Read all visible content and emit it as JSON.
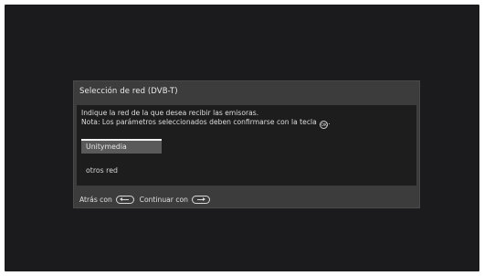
{
  "dialog": {
    "title": "Selección de red (DVB-T)",
    "instruction": "Indique la red de la que desea recibir las emisoras.",
    "note": "Nota: Los parámetros seleccionados deben confirmarse con la tecla",
    "ok_key_label": "OK",
    "networks": [
      {
        "label": "Unitymedia",
        "selected": true
      },
      {
        "label": "otros red",
        "selected": false
      }
    ],
    "footer": {
      "back_label": "Atrás con",
      "continue_label": "Continuar con"
    }
  },
  "colors": {
    "screen_background": "#1b1b1d",
    "dialog_background": "#3c3c3c",
    "body_background": "#1d1d1e",
    "selected_item": "#5a5a5a",
    "text": "#e6e6e6"
  },
  "icons": {
    "ok_key": "ok-button-icon",
    "back_key": "back-button-icon",
    "continue_key": "forward-button-icon"
  }
}
